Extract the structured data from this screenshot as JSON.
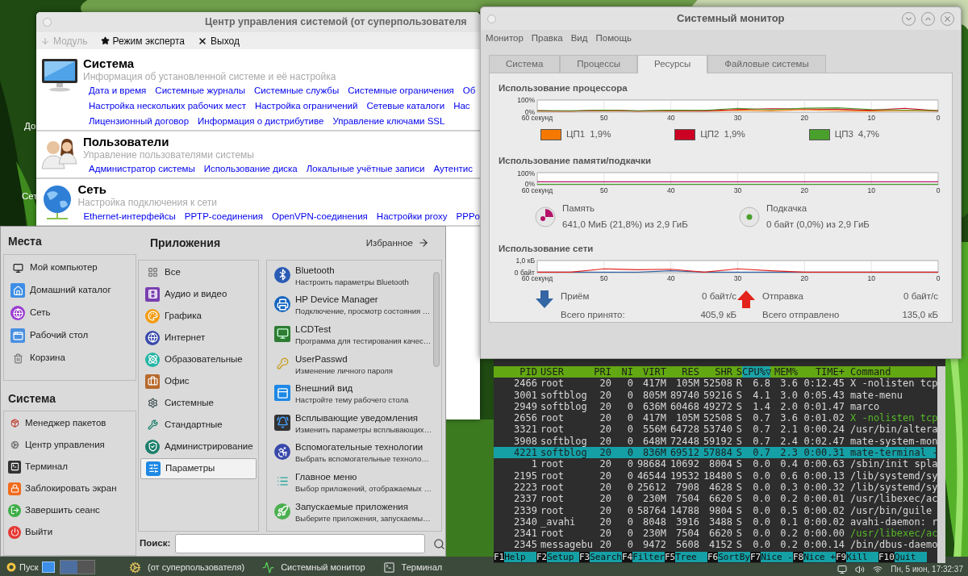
{
  "desktop": {
    "icons": [
      {
        "label": "До"
      },
      {
        "label": "Сет"
      }
    ]
  },
  "control_center": {
    "title": "Центр управления системой (от суперпользователя",
    "toolbar": [
      {
        "label": "Модуль",
        "kind": "module",
        "disabled": true
      },
      {
        "label": "Режим эксперта",
        "kind": "expert",
        "disabled": false
      },
      {
        "label": "Выход",
        "kind": "exit",
        "disabled": false
      }
    ],
    "sections": [
      {
        "kind": "system",
        "title": "Система",
        "subtitle": "Информация об установленной системе и её настройка",
        "link_rows": [
          [
            "Дата и время",
            "Системные журналы",
            "Системные службы",
            "Системные ограничения",
            "Об"
          ],
          [
            "Настройка нескольких рабочих мест",
            "Настройка ограничений",
            "Сетевые каталоги",
            "Нас"
          ],
          [
            "Лицензионный договор",
            "Информация о дистрибутиве",
            "Управление ключами SSL"
          ]
        ]
      },
      {
        "kind": "users",
        "title": "Пользователи",
        "subtitle": "Управление пользователями системы",
        "link_rows": [
          [
            "Администратор системы",
            "Использование диска",
            "Локальные учётные записи",
            "Аутентис"
          ]
        ]
      },
      {
        "kind": "network",
        "title": "Сеть",
        "subtitle": "Настройка подключения к сети",
        "link_rows": [
          [
            "Ethernet-интерфейсы",
            "PPTP-соединения",
            "OpenVPN-соединения",
            "Настройки proxy",
            "PPPo"
          ]
        ]
      }
    ]
  },
  "system_monitor": {
    "title": "Системный монитор",
    "menu": [
      "Монитор",
      "Правка",
      "Вид",
      "Помощь"
    ],
    "tabs": [
      {
        "label": "Система",
        "selected": false
      },
      {
        "label": "Процессы",
        "selected": false
      },
      {
        "label": "Ресурсы",
        "selected": true
      },
      {
        "label": "Файловые системы",
        "selected": false
      }
    ],
    "cpu": {
      "title": "Использование процессора",
      "graph": {
        "y_labels": [
          "100%",
          "0%"
        ],
        "x_labels": [
          "60 секунд",
          "50",
          "40",
          "30",
          "20",
          "10",
          "0"
        ]
      },
      "legend": [
        {
          "label": "ЦП1",
          "value": "1,9%",
          "color": "#f57900"
        },
        {
          "label": "ЦП2",
          "value": "1,9%",
          "color": "#cc0022"
        },
        {
          "label": "ЦП3",
          "value": "4,7%",
          "color": "#4aa02c"
        }
      ]
    },
    "memory": {
      "title": "Использование памяти/подкачки",
      "chart_data": {
        "type": "line",
        "x": [
          60,
          0
        ],
        "xlim": [
          60,
          0
        ],
        "ylim": [
          0,
          100
        ],
        "grid": true,
        "xticks": [
          {
            "value": 60,
            "label": "60 секунд"
          },
          50,
          40,
          30,
          20,
          10,
          0
        ],
        "yticks": [
          {
            "value": 0,
            "label": "0%"
          },
          {
            "value": 100,
            "label": "100%"
          }
        ],
        "series": [
          {
            "name": "Память",
            "color": "#b5136a",
            "values": [
              22,
              22
            ]
          },
          {
            "name": "Подкачка",
            "color": "#4aa02c",
            "values": [
              0,
              0
            ]
          }
        ]
      },
      "legend": [
        {
          "value": "641,0 МиБ (21,8%) из 2,9 ГиБ"
        },
        {
          "value": "0 байт (0,0%) из 2,9 ГиБ"
        }
      ]
    },
    "network": {
      "title": "Использование сети",
      "graph": {
        "y_labels": [
          "1,0 кБ",
          "0 байт"
        ],
        "x_labels": [
          "60 секунд",
          "50",
          "40",
          "30",
          "20",
          "10",
          "0"
        ]
      },
      "legend": [
        {
          "label": "Приём",
          "rate": "0 байт/с",
          "total_label": "Всего принято:",
          "total": "405,9 кБ",
          "color": "#3465a4"
        },
        {
          "label": "Отправка",
          "rate": "0 байт/с",
          "total_label": "Всего отправлено",
          "total": "135,0 кБ",
          "color": "#e3221c"
        }
      ]
    }
  },
  "menu": {
    "places_title": "Места",
    "places": [
      {
        "label": "Мой компьютер",
        "kind": "computer"
      },
      {
        "label": "Домашний каталог",
        "kind": "home"
      },
      {
        "label": "Сеть",
        "kind": "network"
      },
      {
        "label": "Рабочий стол",
        "kind": "desktop"
      },
      {
        "label": "Корзина",
        "kind": "trash"
      }
    ],
    "system_title": "Система",
    "system": [
      {
        "label": "Менеджер пакетов",
        "kind": "packages"
      },
      {
        "label": "Центр управления",
        "kind": "control"
      },
      {
        "label": "Терминал",
        "kind": "terminal"
      },
      {
        "label": "Заблокировать экран",
        "kind": "lock"
      },
      {
        "label": "Завершить сеанс",
        "kind": "logout"
      },
      {
        "label": "Выйти",
        "kind": "quit"
      }
    ],
    "apps_title": "Приложения",
    "favorites": "Избранное",
    "categories": [
      {
        "label": "Все",
        "kind": "all",
        "selected": false
      },
      {
        "label": "Аудио и видео",
        "kind": "media",
        "selected": false
      },
      {
        "label": "Графика",
        "kind": "graphics",
        "selected": false
      },
      {
        "label": "Интернет",
        "kind": "internet",
        "selected": false
      },
      {
        "label": "Образовательные",
        "kind": "education",
        "selected": false
      },
      {
        "label": "Офис",
        "kind": "office",
        "selected": false
      },
      {
        "label": "Системные",
        "kind": "system",
        "selected": false
      },
      {
        "label": "Стандартные",
        "kind": "accessories",
        "selected": false
      },
      {
        "label": "Администрирование",
        "kind": "admin",
        "selected": false
      },
      {
        "label": "Параметры",
        "kind": "settings",
        "selected": true
      }
    ],
    "apps": [
      {
        "name": "Bluetooth",
        "description": "Настроить параметры Bluetooth",
        "kind": "bluetooth"
      },
      {
        "name": "HP Device Manager",
        "description": "Подключение, просмотр состояния …",
        "kind": "printer"
      },
      {
        "name": "LCDTest",
        "description": "Программа для тестирования качес…",
        "kind": "lcd"
      },
      {
        "name": "UserPasswd",
        "description": "Изменение личного пароля",
        "kind": "keys"
      },
      {
        "name": "Внешний вид",
        "description": "Настройте тему рабочего стола",
        "kind": "appearance"
      },
      {
        "name": "Всплывающие уведомления",
        "description": "Изменить параметры всплывающих…",
        "kind": "notify"
      },
      {
        "name": "Вспомогательные технологии",
        "description": "Выбрать вспомогательные техноло…",
        "kind": "accessibility"
      },
      {
        "name": "Главное меню",
        "description": "Выбор приложений, отображаемых …",
        "kind": "mainmenu"
      },
      {
        "name": "Запускаемые приложения",
        "description": "Выберите приложения, запускаемы…",
        "kind": "startup"
      }
    ],
    "search_label": "Поиск:"
  },
  "terminal": {
    "columns": [
      {
        "label": "PID",
        "sorted": false
      },
      {
        "label": "USER",
        "sorted": false
      },
      {
        "label": "PRI",
        "sorted": false
      },
      {
        "label": "NI",
        "sorted": false
      },
      {
        "label": "VIRT",
        "sorted": false
      },
      {
        "label": "RES",
        "sorted": false
      },
      {
        "label": "SHR",
        "sorted": false
      },
      {
        "label": "S",
        "sorted": false
      },
      {
        "label": "CPU%▽",
        "sorted": true
      },
      {
        "label": "MEM%",
        "sorted": false
      },
      {
        "label": "TIME+",
        "sorted": false
      },
      {
        "label": "Command",
        "sorted": false
      }
    ],
    "rows": [
      {
        "cells": [
          "2466",
          "root",
          "20",
          "0",
          "417M",
          "105M",
          "52508",
          "R",
          "6.8",
          "3.6",
          "0:12.45",
          "X -nolisten tcp"
        ],
        "selected": false,
        "thread": false
      },
      {
        "cells": [
          "3001",
          "softblog",
          "20",
          "0",
          "805M",
          "89740",
          "59216",
          "S",
          "4.1",
          "3.0",
          "0:05.43",
          "mate-menu"
        ],
        "selected": false,
        "thread": false
      },
      {
        "cells": [
          "2949",
          "softblog",
          "20",
          "0",
          "636M",
          "60468",
          "49272",
          "S",
          "1.4",
          "2.0",
          "0:01.47",
          "marco"
        ],
        "selected": false,
        "thread": false
      },
      {
        "cells": [
          "2656",
          "root",
          "20",
          "0",
          "417M",
          "105M",
          "52508",
          "S",
          "0.7",
          "3.6",
          "0:01.02",
          "X -nolisten tcp"
        ],
        "selected": false,
        "thread": true
      },
      {
        "cells": [
          "3321",
          "root",
          "20",
          "0",
          "556M",
          "64728",
          "53740",
          "S",
          "0.7",
          "2.1",
          "0:00.24",
          "/usr/bin/altera"
        ],
        "selected": false,
        "thread": false
      },
      {
        "cells": [
          "3908",
          "softblog",
          "20",
          "0",
          "648M",
          "72448",
          "59192",
          "S",
          "0.7",
          "2.4",
          "0:02.47",
          "mate-system-mon"
        ],
        "selected": false,
        "thread": false
      },
      {
        "cells": [
          "4221",
          "softblog",
          "20",
          "0",
          "836M",
          "69512",
          "57884",
          "S",
          "0.7",
          "2.3",
          "0:00.31",
          "mate-terminal -"
        ],
        "selected": true,
        "thread": false
      },
      {
        "cells": [
          "1",
          "root",
          "20",
          "0",
          "98684",
          "10692",
          "8004",
          "S",
          "0.0",
          "0.4",
          "0:00.63",
          "/sbin/init spla"
        ],
        "selected": false,
        "thread": false
      },
      {
        "cells": [
          "2195",
          "root",
          "20",
          "0",
          "46544",
          "19532",
          "18480",
          "S",
          "0.0",
          "0.6",
          "0:00.13",
          "/lib/systemd/sy"
        ],
        "selected": false,
        "thread": false
      },
      {
        "cells": [
          "2223",
          "root",
          "20",
          "0",
          "25612",
          "7908",
          "4628",
          "S",
          "0.0",
          "0.3",
          "0:00.32",
          "/lib/systemd/sy"
        ],
        "selected": false,
        "thread": false
      },
      {
        "cells": [
          "2337",
          "root",
          "20",
          "0",
          "230M",
          "7504",
          "6620",
          "S",
          "0.0",
          "0.2",
          "0:00.01",
          "/usr/libexec/ac"
        ],
        "selected": false,
        "thread": false
      },
      {
        "cells": [
          "2339",
          "root",
          "20",
          "0",
          "58764",
          "14788",
          "9804",
          "S",
          "0.0",
          "0.5",
          "0:00.02",
          "/usr/bin/guile"
        ],
        "selected": false,
        "thread": false
      },
      {
        "cells": [
          "2340",
          "_avahi",
          "20",
          "0",
          "8048",
          "3916",
          "3488",
          "S",
          "0.0",
          "0.1",
          "0:00.02",
          "avahi-daemon: r"
        ],
        "selected": false,
        "thread": false
      },
      {
        "cells": [
          "2341",
          "root",
          "20",
          "0",
          "230M",
          "7504",
          "6620",
          "S",
          "0.0",
          "0.2",
          "0:00.00",
          "/usr/libexec/ac"
        ],
        "selected": false,
        "thread": true
      },
      {
        "cells": [
          "2345",
          "messagebu",
          "20",
          "0",
          "9472",
          "5608",
          "4152",
          "S",
          "0.0",
          "0.2",
          "0:00.14",
          "/bin/dbus-daemo"
        ],
        "selected": false,
        "thread": false
      }
    ],
    "keys": [
      {
        "key": "F1",
        "label": "Help"
      },
      {
        "key": "F2",
        "label": "Setup"
      },
      {
        "key": "F3",
        "label": "Search"
      },
      {
        "key": "F4",
        "label": "Filter"
      },
      {
        "key": "F5",
        "label": "Tree"
      },
      {
        "key": "F6",
        "label": "SortBy"
      },
      {
        "key": "F7",
        "label": "Nice -"
      },
      {
        "key": "F8",
        "label": "Nice +"
      },
      {
        "key": "F9",
        "label": "Kill"
      },
      {
        "key": "F10",
        "label": "Quit"
      }
    ]
  },
  "taskbar": {
    "start": "Пуск",
    "tasks": [
      {
        "label": "(от суперпользователя)",
        "kind": "control"
      },
      {
        "label": "Системный монитор",
        "kind": "monitor"
      },
      {
        "label": "Терминал",
        "kind": "terminal"
      }
    ],
    "clock": "Пн, 5 июн, 17:32:37"
  }
}
